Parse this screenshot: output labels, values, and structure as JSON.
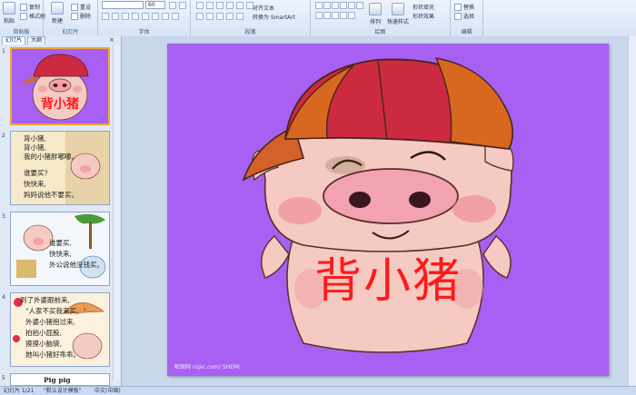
{
  "ribbon": {
    "clipboard": {
      "label": "剪贴板",
      "paste": "粘贴",
      "copy": "复制",
      "format_painter": "格式刷"
    },
    "slides": {
      "label": "幻灯片",
      "new_slide": "新建",
      "reset": "重设",
      "delete": "删除"
    },
    "font": {
      "label": "字体",
      "size": "60"
    },
    "paragraph": {
      "label": "段落",
      "align_text": "对齐文本",
      "smartart": "转换为 SmartArt"
    },
    "drawing": {
      "label": "绘图",
      "arrange": "排列",
      "quick_styles": "快速样式",
      "shape_fill": "形状填充",
      "shape_effects": "形状效果"
    },
    "editing": {
      "label": "编辑",
      "replace": "替换",
      "select": "选择"
    }
  },
  "pane": {
    "tabs": [
      {
        "label": "幻灯片"
      },
      {
        "label": "大纲"
      }
    ],
    "close": "×",
    "thumbnails": [
      {
        "num": "1",
        "title": "背小猪"
      },
      {
        "num": "2",
        "lines": [
          "背小猪,",
          "背小猪,",
          "我的小猪胖嘟嘟。",
          "谁要买?",
          "快快来,",
          "妈妈说他不要买。"
        ]
      },
      {
        "num": "3",
        "lines": [
          "谁要买,",
          "快快来,",
          "外公说他没钱买。"
        ]
      },
      {
        "num": "4",
        "lines": [
          "到了外婆跟前来,",
          "\"人家不买我来买。\"",
          "外婆小猪抱过来,",
          "拍拍小屁股,",
          "摸摸小脑袋,",
          "她叫小猪好乖乖。"
        ]
      },
      {
        "num": "5",
        "lines": [
          "Pig pig"
        ]
      }
    ]
  },
  "slide": {
    "title": "背小猪",
    "watermark": "昵图网 nipic.com/ SHEMI"
  },
  "status": {
    "slide_pos": "幻灯片 1/21",
    "theme": "\"默认设计模板\"",
    "language": "中文(中国)"
  },
  "colors": {
    "slide_bg": "#a860f2",
    "title": "#ff1a1a",
    "cap_red": "#cc2a40",
    "cap_orange": "#d86820",
    "pig": "#f4cac2"
  }
}
